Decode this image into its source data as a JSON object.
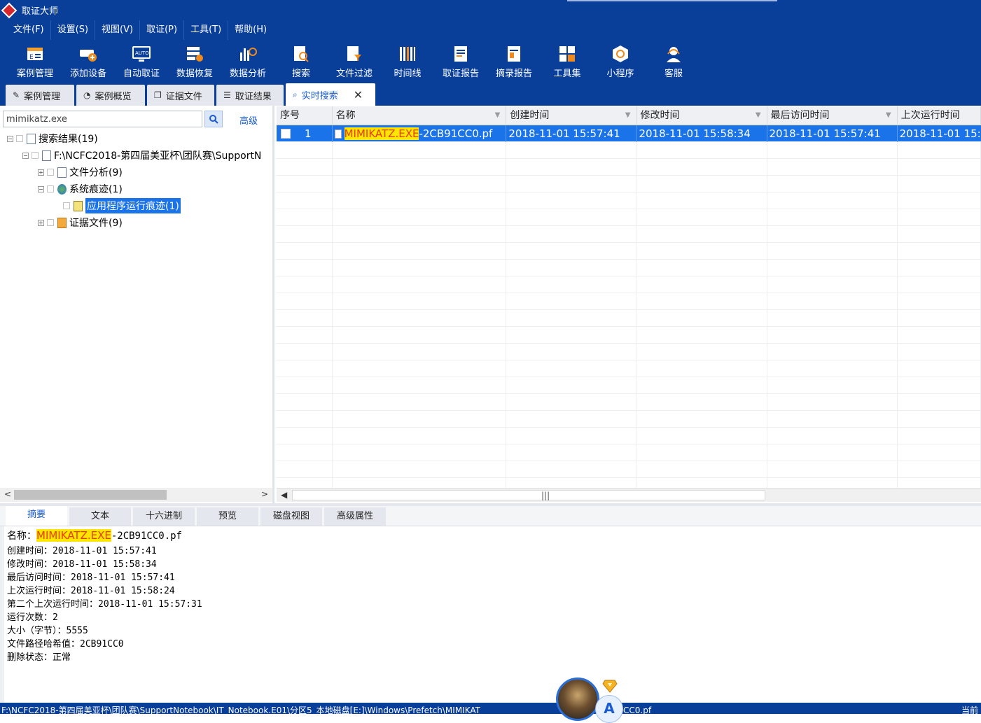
{
  "app": {
    "title": "取证大师"
  },
  "menu": [
    "文件(F)",
    "设置(S)",
    "视图(V)",
    "取证(P)",
    "工具(T)",
    "帮助(H)"
  ],
  "toolbar": [
    {
      "label": "案例管理",
      "icon": "case-manage-icon"
    },
    {
      "label": "添加设备",
      "icon": "add-device-icon"
    },
    {
      "label": "自动取证",
      "icon": "auto-forensics-icon"
    },
    {
      "label": "数据恢复",
      "icon": "data-recovery-icon"
    },
    {
      "label": "数据分析",
      "icon": "data-analysis-icon"
    },
    {
      "label": "搜索",
      "icon": "search-doc-icon"
    },
    {
      "label": "文件过滤",
      "icon": "file-filter-icon"
    },
    {
      "label": "时间线",
      "icon": "timeline-icon"
    },
    {
      "label": "取证报告",
      "icon": "report-icon"
    },
    {
      "label": "摘录报告",
      "icon": "excerpt-report-icon"
    },
    {
      "label": "工具集",
      "icon": "toolset-icon"
    },
    {
      "label": "小程序",
      "icon": "mini-program-icon"
    },
    {
      "label": "客服",
      "icon": "customer-service-icon"
    }
  ],
  "tabs": [
    {
      "label": "案例管理",
      "icon": "edit-icon"
    },
    {
      "label": "案例概览",
      "icon": "pie-icon"
    },
    {
      "label": "证据文件",
      "icon": "copy-icon"
    },
    {
      "label": "取证结果",
      "icon": "result-icon"
    },
    {
      "label": "实时搜索",
      "icon": "magnifier-icon",
      "active": true
    }
  ],
  "search": {
    "value": "mimikatz.exe",
    "advanced": "高级"
  },
  "tree": {
    "root": "搜索结果(19)",
    "evidence_path": "F:\\NCFC2018-第四届美亚杯\\团队赛\\SupportN",
    "file_analysis": "文件分析(9)",
    "system_traces": "系统痕迹(1)",
    "app_traces": "应用程序运行痕迹(1)",
    "evidence_files": "证据文件(9)"
  },
  "grid": {
    "columns": [
      "序号",
      "名称",
      "创建时间",
      "修改时间",
      "最后访问时间",
      "上次运行时间"
    ],
    "rows": [
      {
        "index": "1",
        "name_highlight": "MIMIKATZ.EXE",
        "name_rest": "-2CB91CC0.pf",
        "created": "2018-11-01 15:57:41",
        "modified": "2018-11-01 15:58:34",
        "accessed": "2018-11-01 15:57:41",
        "last_run": "2018-11-01 15:5"
      }
    ]
  },
  "bottom_tabs": [
    "摘要",
    "文本",
    "十六进制",
    "预览",
    "磁盘视图",
    "高级属性"
  ],
  "detail": {
    "name_label": "名称：",
    "name_highlight": "MIMIKATZ.EXE",
    "name_rest": "-2CB91CC0.pf",
    "lines": [
      "创建时间：2018-11-01 15:57:41",
      "修改时间：2018-11-01 15:58:34",
      "最后访问时间：2018-11-01 15:57:41",
      "上次运行时间：2018-11-01 15:58:24",
      "第二个上次运行时间：2018-11-01 15:57:31",
      "运行次数：2",
      "大小（字节）：5555",
      "文件路径哈希值：2CB91CC0",
      "删除状态：正常"
    ]
  },
  "status": {
    "path": "F:\\NCFC2018-第四届美亚杯\\团队赛\\SupportNotebook\\IT_Notebook.E01\\分区5_本地磁盘[E:]\\Windows\\Prefetch\\MIMIKAT",
    "path_tail": "CC0.pf",
    "right": "当前"
  },
  "assistant": {
    "letter": "A"
  },
  "colors": {
    "primary": "#0a3f99",
    "selection": "#1a73e8",
    "highlight_bg": "#ffe600",
    "highlight_fg": "#e83c00"
  }
}
